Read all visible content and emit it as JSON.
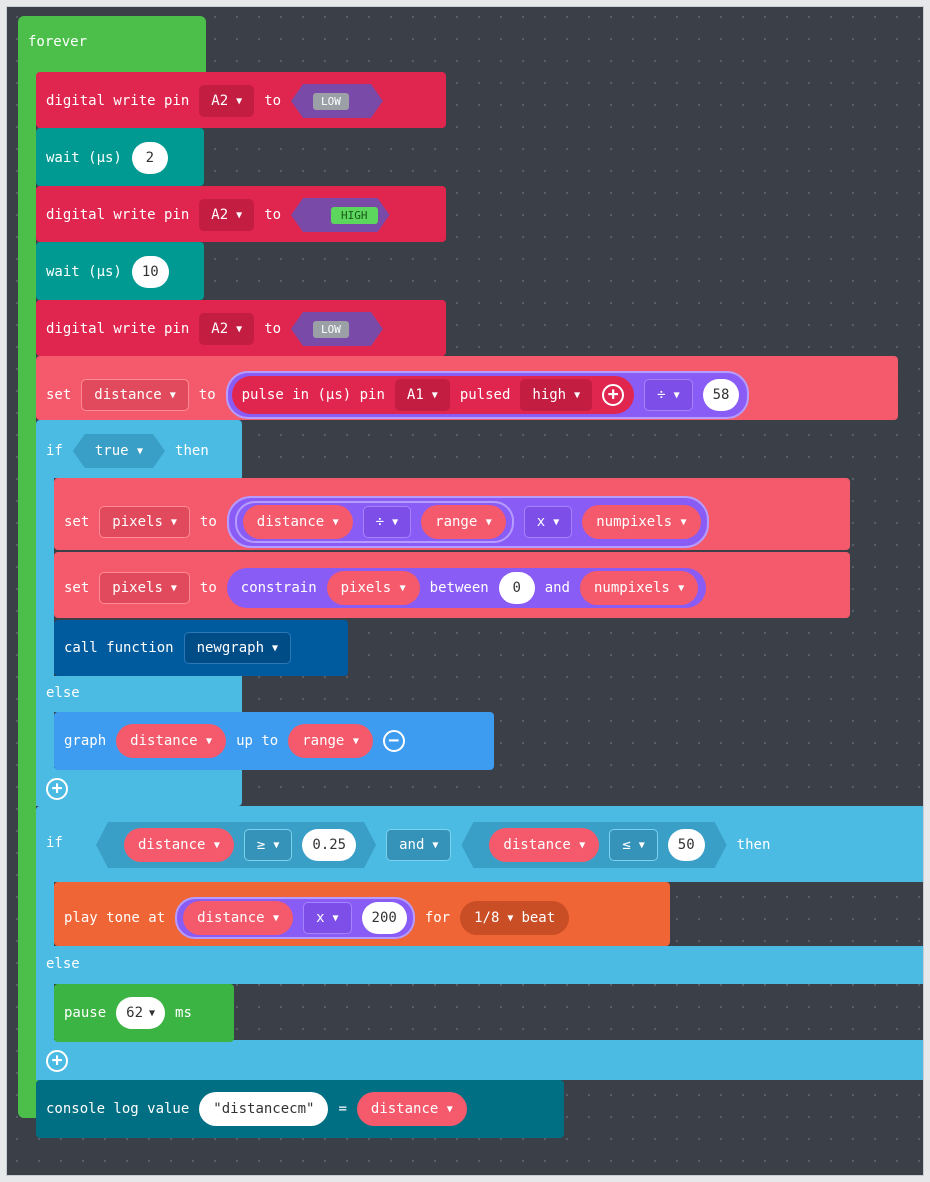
{
  "forever": {
    "label": "forever"
  },
  "dw1": {
    "label": "digital write pin",
    "pin": "A2",
    "to": "to",
    "state": "LOW"
  },
  "wait1": {
    "label": "wait (µs)",
    "value": "2"
  },
  "dw2": {
    "label": "digital write pin",
    "pin": "A2",
    "to": "to",
    "state": "HIGH"
  },
  "wait2": {
    "label": "wait (µs)",
    "value": "10"
  },
  "dw3": {
    "label": "digital write pin",
    "pin": "A2",
    "to": "to",
    "state": "LOW"
  },
  "set_distance": {
    "set": "set",
    "var": "distance",
    "to": "to",
    "pulse_label": "pulse in (µs) pin",
    "pin": "A1",
    "pulsed": "pulsed",
    "level": "high",
    "op": "÷",
    "divisor": "58"
  },
  "if1": {
    "if": "if",
    "cond": "true",
    "then": "then",
    "set_pixels_1": {
      "set": "set",
      "var": "pixels",
      "to": "to",
      "a": "distance",
      "div": "÷",
      "b": "range",
      "mul": "x",
      "c": "numpixels"
    },
    "set_pixels_2": {
      "set": "set",
      "var": "pixels",
      "to": "to",
      "constrain": "constrain",
      "value": "pixels",
      "between": "between",
      "low": "0",
      "and": "and",
      "high": "numpixels"
    },
    "call": {
      "label": "call function",
      "fn": "newgraph"
    },
    "else": "else",
    "graph": {
      "label": "graph",
      "value": "distance",
      "upto": "up to",
      "max": "range"
    }
  },
  "if2": {
    "if": "if",
    "left": {
      "a": "distance",
      "op": "≥",
      "b": "0.25"
    },
    "and": "and",
    "right": {
      "a": "distance",
      "op": "≤",
      "b": "50"
    },
    "then": "then",
    "tone": {
      "label": "play tone at",
      "a": "distance",
      "op": "x",
      "b": "200",
      "for": "for",
      "beat_value": "1/8",
      "beat": "beat"
    },
    "else": "else",
    "pause": {
      "label": "pause",
      "value": "62",
      "unit": "ms"
    }
  },
  "console": {
    "label": "console log value",
    "key": "\"distancecm\"",
    "eq": "=",
    "value": "distance"
  },
  "colors": {
    "events": "#4cbf4b",
    "pins": "#e0264f",
    "control": "#009a93",
    "variables": "#f45a6c",
    "logic": "#4cbbe3",
    "math": "#8a5cf6",
    "functions": "#005a9e",
    "led": "#3d9bf0",
    "music": "#f06535",
    "basic": "#3cb443",
    "console": "#006e83"
  }
}
